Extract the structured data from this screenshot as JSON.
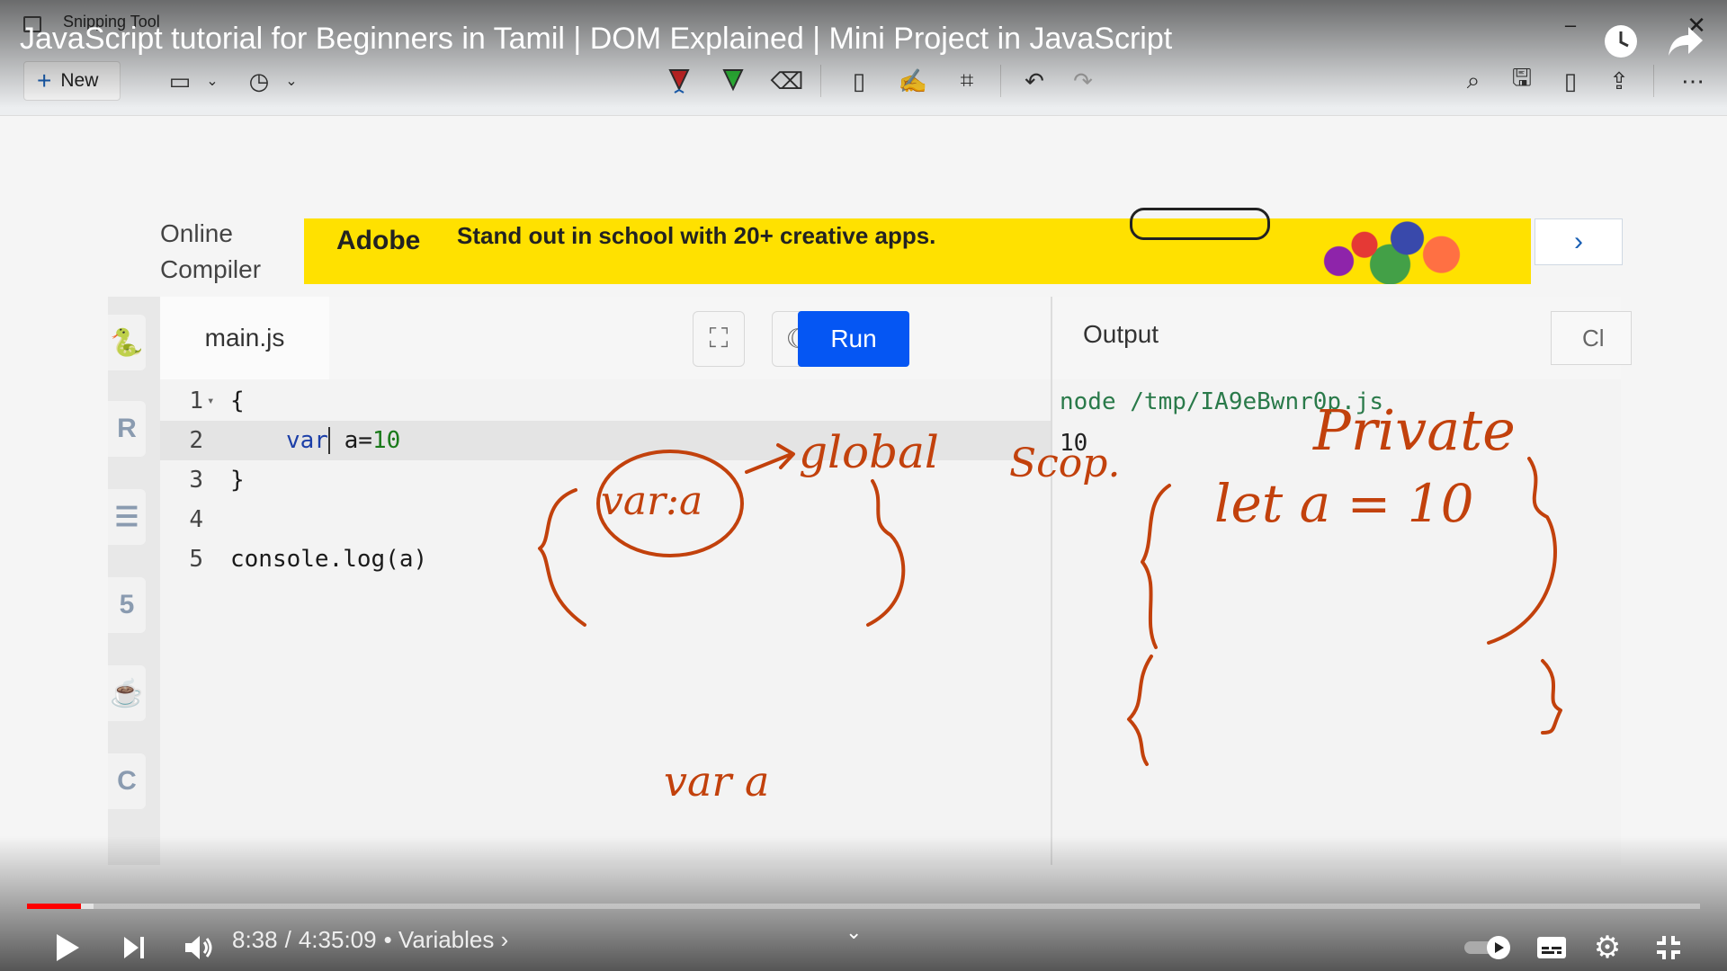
{
  "youtube": {
    "title": "JavaScript tutorial for Beginners in Tamil | DOM Explained | Mini Project in JavaScript",
    "top_icons": [
      "watch-later-icon",
      "share-icon"
    ]
  },
  "snipping_tool": {
    "app_title": "Snipping Tool",
    "new_label": "New",
    "toolbar_icons": [
      "snip-mode-icon",
      "delay-timer-icon",
      "ballpoint-pen-icon",
      "highlighter-icon",
      "eraser-icon",
      "ruler-icon",
      "touch-writing-icon",
      "crop-icon",
      "undo-icon",
      "redo-icon",
      "zoom-icon",
      "save-icon",
      "copy-icon",
      "share-icon",
      "more-icon"
    ]
  },
  "compiler": {
    "label_line1": "Online",
    "label_line2": "Compiler",
    "ad": {
      "brand": "Adobe",
      "text": "Stand out in school with 20+ creative apps.",
      "next_icon": "chevron-right-icon"
    },
    "file_tab": "main.js",
    "run_label": "Run",
    "output_label": "Output",
    "clear_label": "Cl",
    "code_lines": [
      {
        "num": "1",
        "kw": "",
        "text": "{",
        "fold": "▾",
        "val": ""
      },
      {
        "num": "2",
        "kw": "var",
        "text": " a=",
        "fold": "",
        "val": "10"
      },
      {
        "num": "3",
        "kw": "",
        "text": "}",
        "fold": "",
        "val": ""
      },
      {
        "num": "4",
        "kw": "",
        "text": "",
        "fold": "",
        "val": ""
      },
      {
        "num": "5",
        "kw": "",
        "text": "console.log(a)",
        "fold": "",
        "val": ""
      }
    ],
    "output_command": "node /tmp/IA9eBwnr0p.js",
    "output_value": "10"
  },
  "annotations": {
    "circled": "var:a",
    "arrow_label": "global",
    "scope_note": "Scop.",
    "private_label": "Private",
    "let_statement": "let a = 10",
    "bottom_note": "var a"
  },
  "player": {
    "current_time": "8:38",
    "separator": "/",
    "duration": "4:35:09",
    "chapter": "• Variables ›",
    "progress_fraction": 0.032,
    "icons": [
      "play-icon",
      "next-icon",
      "volume-icon",
      "autoplay-toggle",
      "subtitles-icon",
      "settings-icon",
      "exit-fullscreen-icon"
    ]
  },
  "colors": {
    "run_button": "#0556f3",
    "ad_background": "#ffe100",
    "ink": "#c2410c",
    "progress_played": "#ff0000"
  }
}
